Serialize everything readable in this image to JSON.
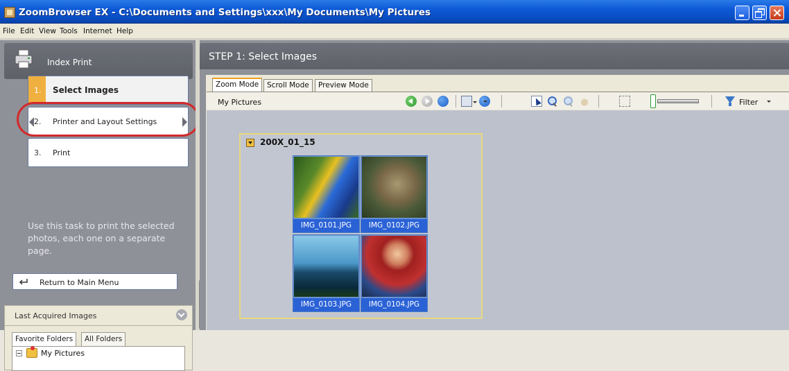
{
  "window": {
    "title": "ZoomBrowser EX  -  C:\\Documents and Settings\\xxx\\My Documents\\My Pictures"
  },
  "menu": [
    "File",
    "Edit",
    "View",
    "Tools",
    "Internet",
    "Help"
  ],
  "task_panel": {
    "title": "Index Print",
    "steps": [
      {
        "num": "1.",
        "label": "Select Images",
        "active": true
      },
      {
        "num": "2.",
        "label": "Printer and Layout Settings",
        "highlighted": true
      },
      {
        "num": "3.",
        "label": "Print"
      }
    ],
    "description": "Use this task to print the selected photos, each one on a separate page.",
    "return_button": "Return to Main Menu"
  },
  "last_acquired": {
    "title": "Last Acquired Images",
    "tabs": [
      "Favorite Folders",
      "All Folders"
    ],
    "tree_root": "My Pictures"
  },
  "main": {
    "step_title": "STEP 1: Select Images",
    "tabs": [
      "Zoom Mode",
      "Scroll Mode",
      "Preview Mode"
    ],
    "active_tab": "Zoom Mode",
    "path": "My Pictures",
    "filter_label": "Filter",
    "group_label": "200X_01_15",
    "thumbnails": [
      "IMG_0101.JPG",
      "IMG_0102.JPG",
      "IMG_0103.JPG",
      "IMG_0104.JPG"
    ]
  },
  "colors": {
    "titlebar": "#0d59d6",
    "panel_bg": "#8f9198",
    "active_step": "#f0b040",
    "highlight_ring": "#d22a2a",
    "selection": "#2a62d6"
  }
}
